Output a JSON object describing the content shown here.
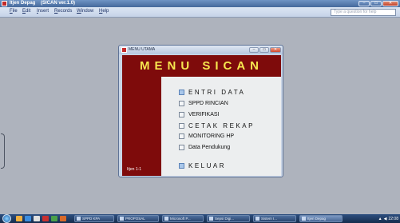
{
  "window": {
    "app_icon": "access-form-icon",
    "title": "Itjen Depag    (SICAN ver.1.0)"
  },
  "menubar": {
    "items": [
      "File",
      "Edit",
      "Insert",
      "Records",
      "Window",
      "Help"
    ],
    "help_placeholder": "Type a question for help"
  },
  "dialog": {
    "title": "MENU UTAMA",
    "banner": "MENU SICAN",
    "user_label": "Itjen 1-1",
    "options": [
      {
        "label": "ENTRI DATA",
        "active": true
      },
      {
        "label": "SPPD RINCIAN",
        "active": false
      },
      {
        "label": "VERIFIKASI",
        "active": false
      },
      {
        "label": "CETAK REKAP",
        "active": false
      },
      {
        "label": "MONITORING HP",
        "active": false
      },
      {
        "label": "Data Pendukung",
        "active": false
      },
      {
        "label": "KELUAR",
        "active": true
      }
    ]
  },
  "taskbar": {
    "tasks": [
      "SPPD KPA",
      "PROPOSAL",
      "Microsoft P...",
      "Sepsi Digi...",
      "Sistem I...",
      "Itjen Depag"
    ],
    "clock": "22:08"
  },
  "colors": {
    "banner_bg": "#7e0b0b",
    "banner_text": "#f6e64f",
    "workspace": "#aeb3bd"
  }
}
